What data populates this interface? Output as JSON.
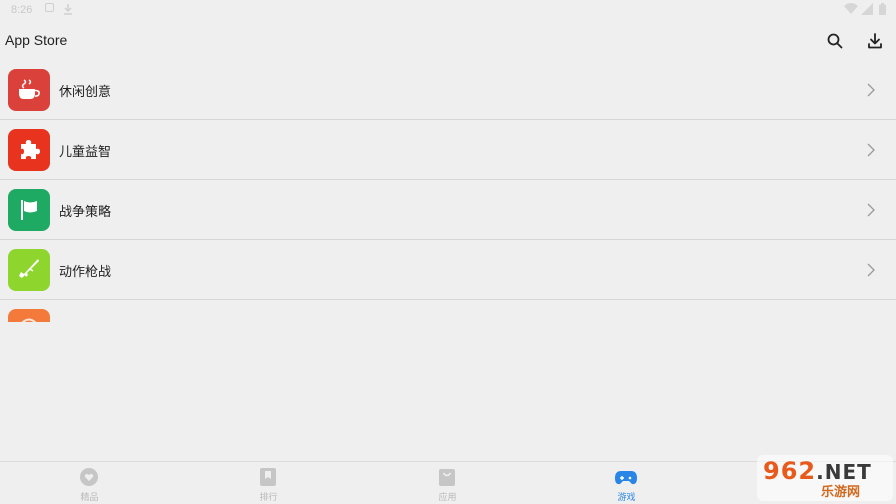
{
  "status_bar": {
    "time": "8:26",
    "icons": [
      "notification-icon",
      "download-icon",
      "wifi-icon",
      "signal-icon",
      "battery-icon"
    ]
  },
  "app_bar": {
    "title": "App Store",
    "actions": [
      "search-icon",
      "download-icon"
    ]
  },
  "categories": [
    {
      "label": "休闲创意",
      "icon": "coffee-cup-icon",
      "color": "#d9413a"
    },
    {
      "label": "儿童益智",
      "icon": "puzzle-icon",
      "color": "#e8341f"
    },
    {
      "label": "战争策略",
      "icon": "flag-icon",
      "color": "#1faa63"
    },
    {
      "label": "动作枪战",
      "icon": "rifle-icon",
      "color": "#8ed62e"
    },
    {
      "label": "",
      "icon": "partial-icon",
      "color": "#f47a3c"
    }
  ],
  "bottom_nav": {
    "tabs": [
      {
        "label": "精品",
        "icon": "heart-icon",
        "active": false
      },
      {
        "label": "排行",
        "icon": "bookmark-icon",
        "active": false
      },
      {
        "label": "应用",
        "icon": "shopping-bag-icon",
        "active": false
      },
      {
        "label": "游戏",
        "icon": "gamepad-icon",
        "active": true
      },
      {
        "label": "",
        "icon": "",
        "active": false
      }
    ],
    "active_color": "#2a86e6",
    "inactive_color": "#b8b8b8"
  },
  "watermark": {
    "number": "962",
    "suffix": ".NET",
    "site": "乐游网"
  }
}
